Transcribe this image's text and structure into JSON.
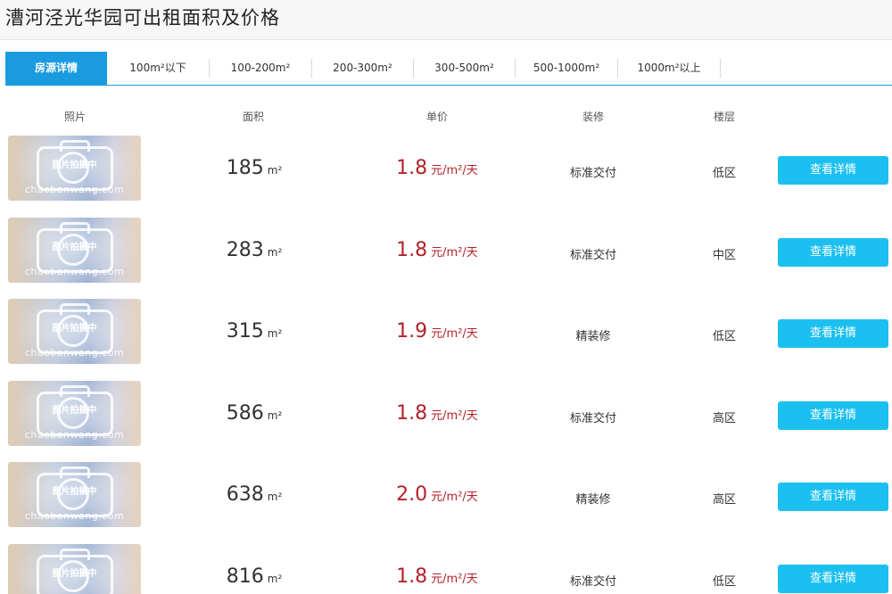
{
  "page": {
    "title": "漕河泾光华园可出租面积及价格"
  },
  "tabs": [
    {
      "label": "房源详情",
      "active": true
    },
    {
      "label": "100m²以下"
    },
    {
      "label": "100-200m²"
    },
    {
      "label": "200-300m²"
    },
    {
      "label": "300-500m²"
    },
    {
      "label": "500-1000m²"
    },
    {
      "label": "1000m²以上"
    }
  ],
  "table": {
    "headers": {
      "photo": "照片",
      "area": "面积",
      "price": "单价",
      "decoration": "装修",
      "floor": "楼层"
    },
    "area_unit": "m²",
    "price_unit": "元/m²/天",
    "button_label": "查看详情",
    "photo_placeholder": "图片拍摄中",
    "photo_watermark": "chaobanwang.com",
    "rows": [
      {
        "area": "185",
        "price": "1.8",
        "decoration": "标准交付",
        "floor": "低区"
      },
      {
        "area": "283",
        "price": "1.8",
        "decoration": "标准交付",
        "floor": "中区"
      },
      {
        "area": "315",
        "price": "1.9",
        "decoration": "精装修",
        "floor": "低区"
      },
      {
        "area": "586",
        "price": "1.8",
        "decoration": "标准交付",
        "floor": "高区"
      },
      {
        "area": "638",
        "price": "2.0",
        "decoration": "精装修",
        "floor": "高区"
      },
      {
        "area": "816",
        "price": "1.8",
        "decoration": "标准交付",
        "floor": "低区"
      }
    ]
  },
  "colors": {
    "accent": "#1a9be0",
    "button": "#1cc0f0",
    "price": "#b3212a"
  }
}
